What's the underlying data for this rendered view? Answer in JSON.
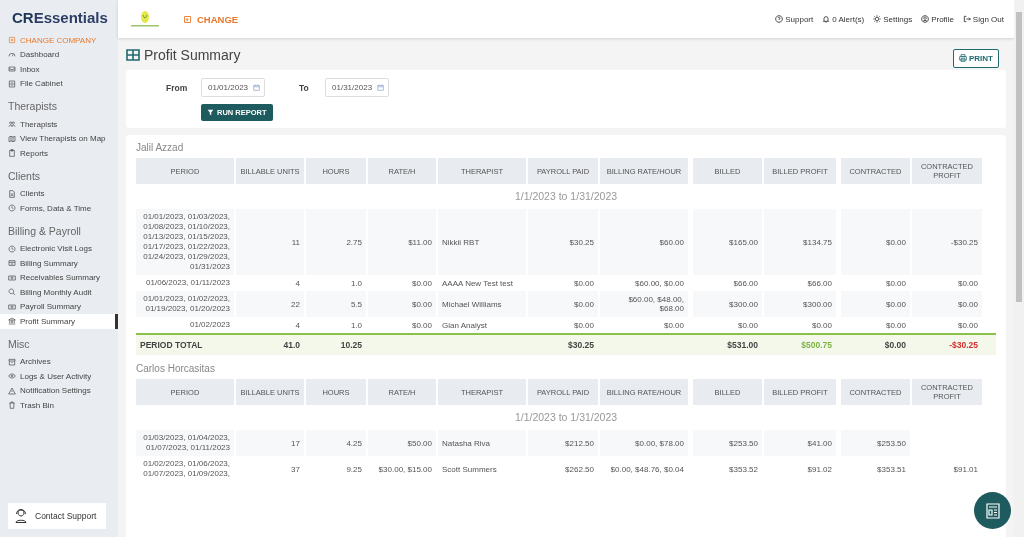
{
  "brand": {
    "mark": "CR",
    "name": "Essentials"
  },
  "header": {
    "change_label": "CHANGE",
    "links": [
      "Support",
      "0 Alert(s)",
      "Settings",
      "Profile",
      "Sign Out"
    ]
  },
  "sidebar": {
    "top_items": [
      {
        "label": "CHANGE COMPANY",
        "kind": "action",
        "selected": false
      },
      {
        "label": "Dashboard",
        "kind": "link",
        "selected": false
      },
      {
        "label": "Inbox",
        "kind": "link",
        "selected": false
      },
      {
        "label": "File Cabinet",
        "kind": "link",
        "selected": false
      }
    ],
    "sections": [
      {
        "title": "Therapists",
        "items": [
          {
            "label": "Therapists",
            "selected": false
          },
          {
            "label": "View Therapists on Map",
            "selected": false
          },
          {
            "label": "Reports",
            "selected": false
          }
        ]
      },
      {
        "title": "Clients",
        "items": [
          {
            "label": "Clients",
            "selected": false
          },
          {
            "label": "Forms, Data & Time",
            "selected": false
          }
        ]
      },
      {
        "title": "Billing & Payroll",
        "items": [
          {
            "label": "Electronic Visit Logs",
            "selected": false
          },
          {
            "label": "Billing Summary",
            "selected": false
          },
          {
            "label": "Receivables Summary",
            "selected": false
          },
          {
            "label": "Billing Monthly Audit",
            "selected": false
          },
          {
            "label": "Payroll Summary",
            "selected": false
          },
          {
            "label": "Profit Summary",
            "selected": true
          }
        ]
      },
      {
        "title": "Misc",
        "items": [
          {
            "label": "Archives",
            "selected": false
          },
          {
            "label": "Logs & User Activity",
            "selected": false
          },
          {
            "label": "Notification Settings",
            "selected": false
          },
          {
            "label": "Trash Bin",
            "selected": false
          }
        ]
      }
    ],
    "contact_support": "Contact Support"
  },
  "page": {
    "title": "Profit Summary",
    "print_button": "PRINT"
  },
  "filter": {
    "from_label": "From",
    "from_value": "01/01/2023",
    "to_label": "To",
    "to_value": "01/31/2023",
    "run_button": "RUN REPORT"
  },
  "reports": [
    {
      "name": "Jalil Azzad",
      "columns": [
        "PERIOD",
        "BILLABLE UNITS",
        "HOURS",
        "RATE/H",
        "THERAPIST",
        "PAYROLL PAID",
        "BILLING RATE/HOUR",
        "BILLED",
        "BILLED PROFIT",
        "CONTRACTED",
        "CONTRACTED PROFIT"
      ],
      "range": "1/1/2023 to 1/31/2023",
      "rows": [
        [
          "01/01/2023, 01/03/2023, 01/08/2023, 01/10/2023, 01/13/2023, 01/15/2023, 01/17/2023, 01/22/2023, 01/24/2023, 01/29/2023, 01/31/2023",
          "11",
          "2.75",
          "$11.00",
          "Nikkii RBT",
          "$30.25",
          "$60.00",
          "$165.00",
          "$134.75",
          "$0.00",
          "-$30.25"
        ],
        [
          "01/06/2023, 01/11/2023",
          "4",
          "1.0",
          "$0.00",
          "AAAA New Test test",
          "$0.00",
          "$60.00, $0.00",
          "$66.00",
          "$66.00",
          "$0.00",
          "$0.00"
        ],
        [
          "01/01/2023, 01/02/2023, 01/19/2023, 01/20/2023",
          "22",
          "5.5",
          "$0.00",
          "Michael Williams",
          "$0.00",
          "$60.00, $48.00, $68.00",
          "$300.00",
          "$300.00",
          "$0.00",
          "$0.00"
        ],
        [
          "01/02/2023",
          "4",
          "1.0",
          "$0.00",
          "Gian Analyst",
          "$0.00",
          "$0.00",
          "$0.00",
          "$0.00",
          "$0.00",
          "$0.00"
        ]
      ],
      "total": {
        "label": "PERIOD TOTAL",
        "units": "41.0",
        "hours": "10.25",
        "payroll_paid": "$30.25",
        "billed": "$531.00",
        "billed_profit": "$500.75",
        "contracted": "$0.00",
        "contracted_profit": "-$30.25"
      }
    },
    {
      "name": "Carlos Horcasitas",
      "columns": [
        "PERIOD",
        "BILLABLE UNITS",
        "HOURS",
        "RATE/H",
        "THERAPIST",
        "PAYROLL PAID",
        "BILLING RATE/HOUR",
        "BILLED",
        "BILLED PROFIT",
        "CONTRACTED",
        "CONTRACTED PROFIT"
      ],
      "range": "1/1/2023 to 1/31/2023",
      "rows": [
        [
          "01/03/2023, 01/04/2023, 01/07/2023, 01/11/2023",
          "17",
          "4.25",
          "$50.00",
          "Natasha Riva",
          "$212.50",
          "$0.00, $78.00",
          "$253.50",
          "$41.00",
          "$253.50"
        ],
        [
          "01/02/2023, 01/06/2023, 01/07/2023, 01/09/2023,",
          "37",
          "9.25",
          "$30.00, $15.00",
          "Scott Summers",
          "$262.50",
          "$0.00, $48.76, $0.04",
          "$353.52",
          "$91.02",
          "$353.51",
          "$91.01"
        ]
      ]
    }
  ]
}
